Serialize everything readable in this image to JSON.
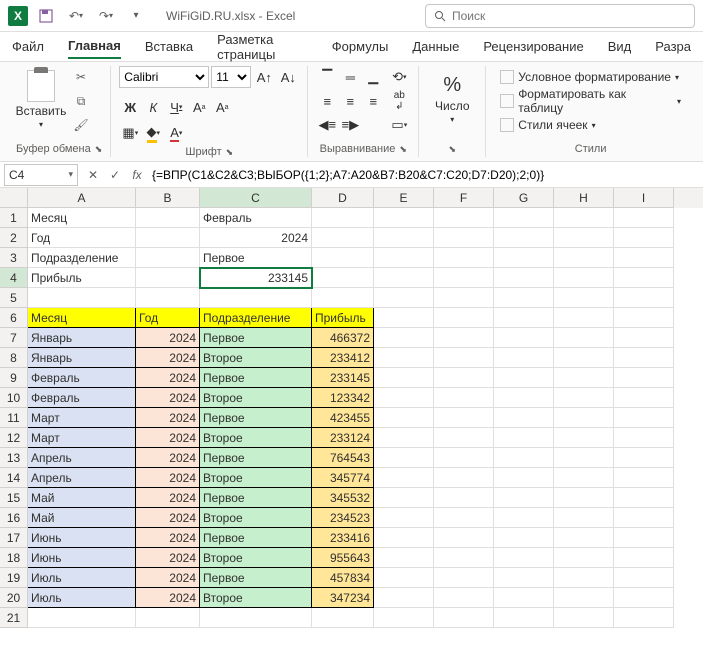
{
  "title": "WiFiGiD.RU.xlsx - Excel",
  "search_placeholder": "Поиск",
  "tabs": [
    "Файл",
    "Главная",
    "Вставка",
    "Разметка страницы",
    "Формулы",
    "Данные",
    "Рецензирование",
    "Вид",
    "Разра"
  ],
  "ribbon": {
    "paste_label": "Вставить",
    "clipboard_label": "Буфер обмена",
    "font_name": "Calibri",
    "font_size": "11",
    "font_label": "Шрифт",
    "align_label": "Выравнивание",
    "number_label": "Число",
    "percent": "%",
    "styles": {
      "cond": "Условное форматирование",
      "table": "Форматировать как таблицу",
      "cell": "Стили ячеек",
      "label": "Стили"
    }
  },
  "name_box": "C4",
  "formula": "{=ВПР(C1&C2&C3;ВЫБОР({1;2};A7:A20&B7:B20&C7:C20;D7:D20);2;0)}",
  "columns": [
    "A",
    "B",
    "C",
    "D",
    "E",
    "F",
    "G",
    "H",
    "I"
  ],
  "top_rows": [
    {
      "n": "1",
      "a": "Месяц",
      "c": "Февраль"
    },
    {
      "n": "2",
      "a": "Год",
      "c": "2024",
      "cr": true
    },
    {
      "n": "3",
      "a": "Подразделение",
      "c": "Первое"
    },
    {
      "n": "4",
      "a": "Прибыль",
      "c": "233145",
      "cr": true,
      "active": true
    }
  ],
  "header_row": {
    "n": "6",
    "a": "Месяц",
    "b": "Год",
    "c": "Подразделение",
    "d": "Прибыль"
  },
  "data_rows": [
    {
      "n": "7",
      "a": "Январь",
      "b": "2024",
      "c": "Первое",
      "d": "466372"
    },
    {
      "n": "8",
      "a": "Январь",
      "b": "2024",
      "c": "Второе",
      "d": "233412"
    },
    {
      "n": "9",
      "a": "Февраль",
      "b": "2024",
      "c": "Первое",
      "d": "233145"
    },
    {
      "n": "10",
      "a": "Февраль",
      "b": "2024",
      "c": "Второе",
      "d": "123342"
    },
    {
      "n": "11",
      "a": "Март",
      "b": "2024",
      "c": "Первое",
      "d": "423455"
    },
    {
      "n": "12",
      "a": "Март",
      "b": "2024",
      "c": "Второе",
      "d": "233124"
    },
    {
      "n": "13",
      "a": "Апрель",
      "b": "2024",
      "c": "Первое",
      "d": "764543"
    },
    {
      "n": "14",
      "a": "Апрель",
      "b": "2024",
      "c": "Второе",
      "d": "345774"
    },
    {
      "n": "15",
      "a": "Май",
      "b": "2024",
      "c": "Первое",
      "d": "345532"
    },
    {
      "n": "16",
      "a": "Май",
      "b": "2024",
      "c": "Второе",
      "d": "234523"
    },
    {
      "n": "17",
      "a": "Июнь",
      "b": "2024",
      "c": "Первое",
      "d": "233416"
    },
    {
      "n": "18",
      "a": "Июнь",
      "b": "2024",
      "c": "Второе",
      "d": "955643"
    },
    {
      "n": "19",
      "a": "Июль",
      "b": "2024",
      "c": "Первое",
      "d": "457834"
    },
    {
      "n": "20",
      "a": "Июль",
      "b": "2024",
      "c": "Второе",
      "d": "347234"
    }
  ],
  "blank_rows": [
    "5",
    "21"
  ]
}
